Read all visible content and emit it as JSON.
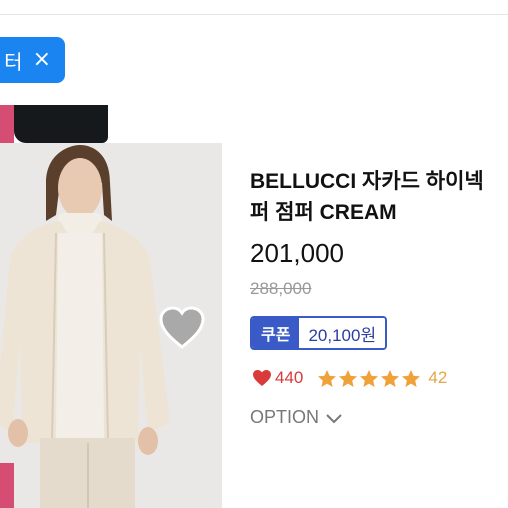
{
  "filter_chip": {
    "label": "터",
    "close_glyph": "×"
  },
  "product": {
    "title_line1": "BELLUCCI 자카드 하이넥",
    "title_line2": "퍼 점퍼 CREAM",
    "price": "201,000",
    "original_price": "288,000",
    "coupon": {
      "tag": "쿠폰",
      "amount": "20,100원"
    },
    "likes": "440",
    "rating_stars": 5,
    "review_count": "42",
    "option_label": "OPTION"
  },
  "colors": {
    "chip_blue": "#1a85f0",
    "coupon_blue": "#3a5bc7",
    "heart_red": "#d93a3a",
    "star_orange": "#f0a23a",
    "tag_pink": "#d64d73"
  },
  "icons": [
    "close-icon",
    "heart-outline-icon",
    "heart-icon",
    "star-icon",
    "chevron-down-icon"
  ]
}
